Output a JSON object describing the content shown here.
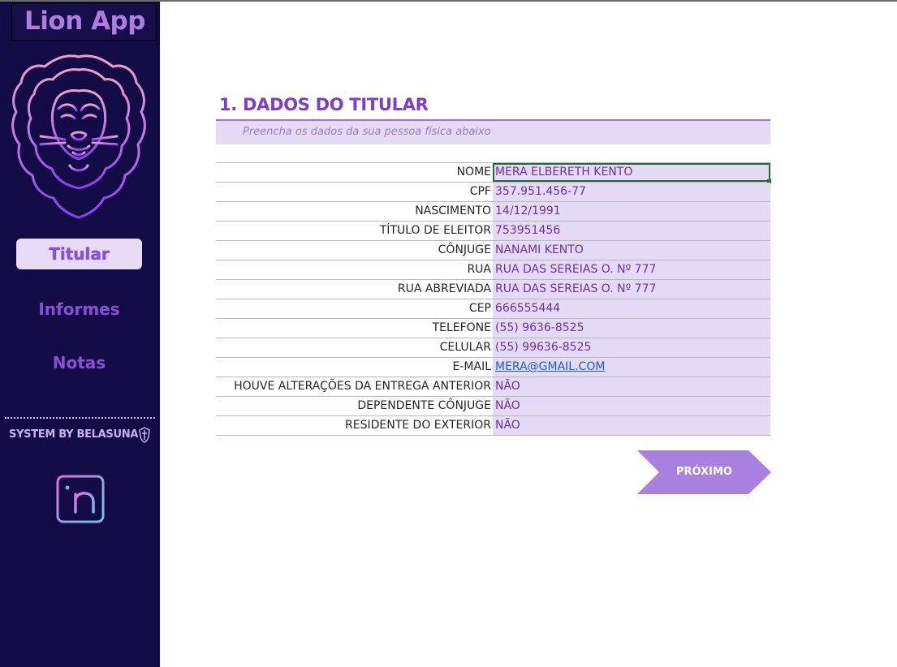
{
  "sidebar": {
    "app_title": "Lion App",
    "nav": {
      "titular": "Titular",
      "informes": "Informes",
      "notas": "Notas"
    },
    "credit": "SYSTEM BY BELASUNA",
    "icons": [
      "lion-logo",
      "shield-sword-icon",
      "linkedin-icon"
    ]
  },
  "main": {
    "title": "1. DADOS DO TITULAR",
    "subtitle": "Preencha os dados da sua pessoa física abaixo",
    "fields": [
      {
        "label": "NOME",
        "value": "MERA ELBERETH KENTO"
      },
      {
        "label": "CPF",
        "value": "357.951.456-77"
      },
      {
        "label": "NASCIMENTO",
        "value": "14/12/1991"
      },
      {
        "label": "TÍTULO DE ELEITOR",
        "value": "753951456"
      },
      {
        "label": "CÔNJUGE",
        "value": "NANAMI KENTO"
      },
      {
        "label": "RUA",
        "value": "RUA DAS SEREIAS O. Nº 777"
      },
      {
        "label": "RUA ABREVIADA",
        "value": "RUA DAS SEREIAS O. Nº 777"
      },
      {
        "label": "CEP",
        "value": "666555444"
      },
      {
        "label": "TELEFONE",
        "value": "(55) 9636-8525"
      },
      {
        "label": "CELULAR",
        "value": "(55) 99636-8525"
      },
      {
        "label": "E-MAIL",
        "value": "MERA@GMAIL.COM"
      },
      {
        "label": "HOUVE ALTERAÇÕES DA ENTREGA ANTERIOR",
        "value": "NÃO"
      },
      {
        "label": "DEPENDENTE CÔNJUGE",
        "value": "NÃO"
      },
      {
        "label": "RESIDENTE DO EXTERIOR",
        "value": "NÃO"
      }
    ],
    "next_button": "PRÓXIMO"
  },
  "colors": {
    "sidebar_bg": "#130b45",
    "accent_purple": "#8a4fd8",
    "field_bg": "#e6dbf5",
    "value_text": "#6a2fb0",
    "button_bg": "#a97fe0"
  }
}
